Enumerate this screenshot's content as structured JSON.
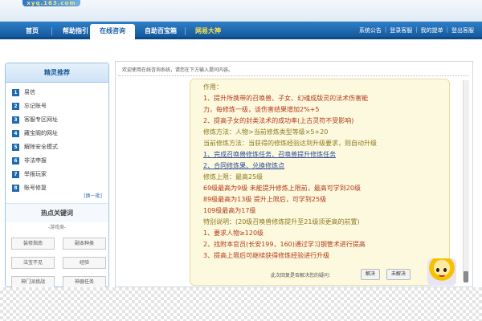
{
  "banner": {
    "logo_text": "xyq.163.com"
  },
  "nav": {
    "tabs": [
      {
        "label": "首页",
        "active": false
      },
      {
        "label": "帮助指引",
        "active": false
      },
      {
        "label": "在线咨询",
        "active": true
      },
      {
        "label": "自助百宝箱",
        "active": false
      },
      {
        "label": "网易大神",
        "active": false,
        "special": true
      }
    ],
    "right_links": [
      "系统公告",
      "登录客服",
      "我的提单",
      "登出客服"
    ]
  },
  "sidebar": {
    "title": "精灵推荐",
    "items": [
      {
        "num": "1",
        "label": "易信"
      },
      {
        "num": "2",
        "label": "忘记账号"
      },
      {
        "num": "3",
        "label": "客服专区网址"
      },
      {
        "num": "4",
        "label": "藏宝阁的网址"
      },
      {
        "num": "5",
        "label": "解除安全模式"
      },
      {
        "num": "6",
        "label": "非法申报"
      },
      {
        "num": "7",
        "label": "举报玩家"
      },
      {
        "num": "8",
        "label": "账号修复"
      }
    ],
    "more_label": "[换一批]",
    "hot_title": "热点关键词",
    "hot_sub": "-游戏类-",
    "keywords": [
      "装修指南",
      "副本种类",
      "法宝不见",
      "经验",
      "神门派挑战",
      "神器任务"
    ]
  },
  "main": {
    "welcome": "欢迎使用在线咨询系统，请您在下方输入提问内容。",
    "panel": {
      "lines": [
        "作用：",
        "1、提升所携带的召唤兽、子女、幻魂成版灵的法术伤害能",
        "力，每修炼一级，该伤害结果增加2%+5",
        "2、提高子女的封类法术的成功率(上古灵符不受影响)",
        "修炼方法：人物>当前修炼类型等级×5+20",
        "当前修炼方法：当获得的修炼经验达到升级要求，则自动升级",
        "1、完成召唤兽修炼任务、召唤兽提升修炼任务",
        "2、合同修炼果、兑换修炼点",
        "修炼上限：最高25级",
        "69级最高为9级      未能提升修炼上限前，最高可学到20级",
        "89级最高为13级      提升上限后，可学到25级",
        "109级最高为17级",
        "特别说明：(20级召唤兽修炼提升至21级须更高的前置)",
        "1、要求人物≥120级",
        "2、找附本官员(长安199，160)通过学习钢管术进行提高",
        "3、提高上限后可继续获得修炼经验进行升级"
      ],
      "question": "此次回复是否解决您的疑问：",
      "resolved_label": "解决",
      "unresolved_label": "未解决"
    }
  }
}
